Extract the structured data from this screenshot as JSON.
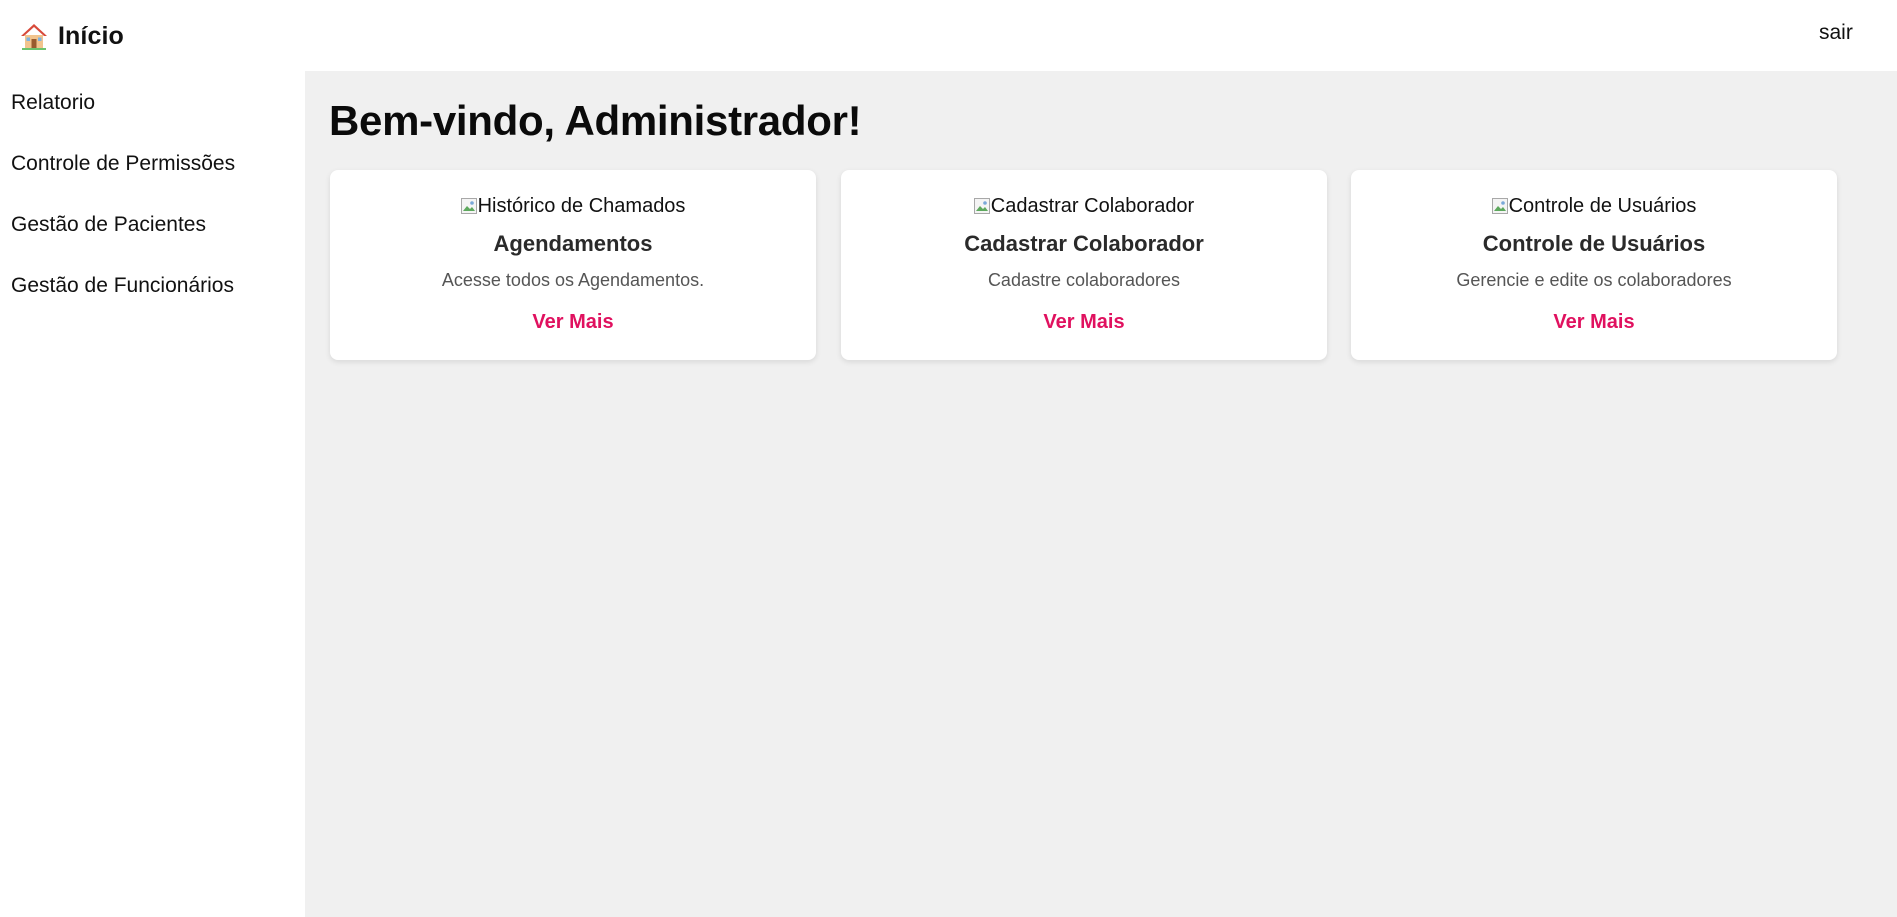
{
  "colors": {
    "accent": "#e0115f",
    "main_background": "#f0f0f0",
    "card_background": "#ffffff",
    "text": "#111111",
    "muted_text": "#555555"
  },
  "header": {
    "brand_icon": "home-icon",
    "brand_label": "Início",
    "logout_label": "sair"
  },
  "sidebar": {
    "items": [
      {
        "label": "Relatorio"
      },
      {
        "label": "Controle de Permissões"
      },
      {
        "label": "Gestão de Pacientes"
      },
      {
        "label": "Gestão de Funcionários"
      }
    ]
  },
  "main": {
    "title": "Bem-vindo, Administrador!",
    "cards": [
      {
        "image_alt": "Histórico de Chamados",
        "title": "Agendamentos",
        "description": "Acesse todos os Agendamentos.",
        "link_label": "Ver Mais"
      },
      {
        "image_alt": "Cadastrar Colaborador",
        "title": "Cadastrar Colaborador",
        "description": "Cadastre colaboradores",
        "link_label": "Ver Mais"
      },
      {
        "image_alt": "Controle de Usuários",
        "title": "Controle de Usuários",
        "description": "Gerencie e edite os colaboradores",
        "link_label": "Ver Mais"
      }
    ]
  }
}
